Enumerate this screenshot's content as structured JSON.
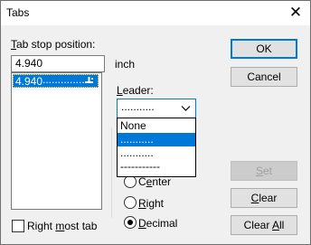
{
  "window": {
    "title": "Tabs",
    "close_glyph": "✕"
  },
  "tab_stop": {
    "label_prefix": "",
    "label_accel": "T",
    "label_rest": "ab stop position:",
    "input_value": "4.940",
    "unit": "inch",
    "list_items": [
      {
        "value": "4.940",
        "leader": ".............."
      }
    ]
  },
  "leader": {
    "label_accel": "L",
    "label_rest": "eader:",
    "selected": "...........",
    "options": [
      "None",
      "...........",
      "...........",
      "-----------"
    ],
    "highlighted_index": 1
  },
  "alignment": {
    "options": [
      {
        "accel_prefix": "C",
        "accel": "e",
        "rest": "nter",
        "checked": false
      },
      {
        "accel_prefix": "",
        "accel": "R",
        "rest": "ight",
        "checked": false
      },
      {
        "accel_prefix": "",
        "accel": "D",
        "rest": "ecimal",
        "checked": true
      }
    ]
  },
  "right_most_tab": {
    "pre": "Right ",
    "accel": "m",
    "post": "ost tab",
    "checked": false
  },
  "buttons": {
    "ok": "OK",
    "cancel": "Cancel",
    "set": "Set",
    "set_accel": "S",
    "set_rest": "et",
    "clear": "Clear",
    "clear_accel": "C",
    "clear_rest": "lear",
    "clear_all": "Clear All",
    "clear_all_pre": "Clear ",
    "clear_all_accel": "A",
    "clear_all_post": "ll"
  }
}
